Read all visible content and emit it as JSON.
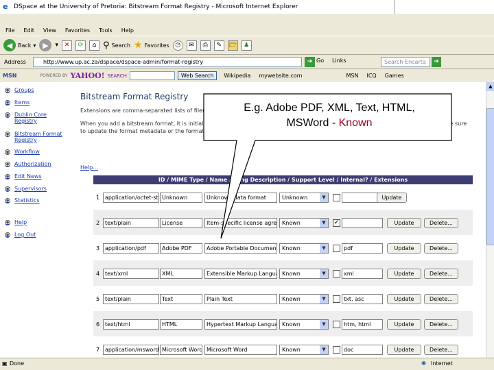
{
  "window": {
    "title": "DSpace at the University of Pretoria: Bitstream Format Registry - Microsoft Internet Explorer"
  },
  "menu": [
    "File",
    "Edit",
    "View",
    "Favorites",
    "Tools",
    "Help"
  ],
  "nav": {
    "back": "Back",
    "search": "Search",
    "favorites": "Favorites"
  },
  "address": {
    "url": "http://www.up.ac.za/dspace/dspace-admin/format-registry",
    "go": "Go",
    "links": "Links",
    "search_placeholder": "Search Encarta"
  },
  "toolbar2": {
    "msn": "MSN",
    "powered": "POWERED BY",
    "yahoo": "YAHOO!",
    "yahoo_search": "SEARCH",
    "web_search": "Web Search",
    "wikipedia": "Wikipedia",
    "mywebsite": "mywebsite.com",
    "msn_tools": "MSN",
    "icq": "ICQ",
    "games": "Games"
  },
  "sidebar": [
    {
      "label": "Groups"
    },
    {
      "label": "Items"
    },
    {
      "label": "Dublin Core Registry"
    },
    {
      "label": "Bitstream Format Registry"
    },
    {
      "label": "Workflow"
    },
    {
      "label": "Authorization"
    },
    {
      "label": "Edit News"
    },
    {
      "label": "Supervisors"
    },
    {
      "label": "Statistics"
    },
    {
      "label": "Help"
    },
    {
      "label": "Log Out"
    }
  ],
  "page": {
    "title": "Bitstream Format Registry",
    "intro1": "Extensions are comma-separated lists of filename extensions used to identify the format of uploaded files. Do not include the dot.",
    "intro2": "When you add a bitstream format, it is initially 'unknown'. Be sure to hit 'Update' when you've finished editing the bitstream format. Be sure to update the format metadata or the format will appear in the submission UI list of formats.",
    "help": "Help..."
  },
  "table": {
    "header": "ID / MIME Type / Name / Long Description / Support Level / Internal? / Extensions",
    "update_label": "Update",
    "delete_label": "Delete...",
    "rows": [
      {
        "id": "1",
        "mime": "application/octet-stream",
        "name": "Unknown",
        "desc": "Unknown data format",
        "support": "Unknown",
        "internal": false,
        "ext": "",
        "deletable": false
      },
      {
        "id": "2",
        "mime": "text/plain",
        "name": "License",
        "desc": "Item-specific license agreed upon",
        "support": "Known",
        "internal": true,
        "ext": "",
        "deletable": true
      },
      {
        "id": "3",
        "mime": "application/pdf",
        "name": "Adobe PDF",
        "desc": "Adobe Portable Document Format",
        "support": "Known",
        "internal": false,
        "ext": "pdf",
        "deletable": true
      },
      {
        "id": "4",
        "mime": "text/xml",
        "name": "XML",
        "desc": "Extensible Markup Language",
        "support": "Known",
        "internal": false,
        "ext": "xml",
        "deletable": true
      },
      {
        "id": "5",
        "mime": "text/plain",
        "name": "Text",
        "desc": "Plain Text",
        "support": "Known",
        "internal": false,
        "ext": "txt, asc",
        "deletable": true
      },
      {
        "id": "6",
        "mime": "text/html",
        "name": "HTML",
        "desc": "Hypertext Markup Language",
        "support": "Known",
        "internal": false,
        "ext": "htm, html",
        "deletable": true
      },
      {
        "id": "7",
        "mime": "application/msword",
        "name": "Microsoft Word",
        "desc": "Microsoft Word",
        "support": "Known",
        "internal": false,
        "ext": "doc",
        "deletable": true
      }
    ]
  },
  "status": {
    "left": "Done",
    "zone": "Internet"
  },
  "callout": {
    "line1": "E.g. Adobe PDF, XML, Text, HTML,",
    "line2": "MSWord - ",
    "known": "Known"
  },
  "colors": {
    "callout_known": "#a0001c",
    "table_header": "#3d3d73",
    "link": "#1e40af",
    "title": "#1f3a60"
  }
}
